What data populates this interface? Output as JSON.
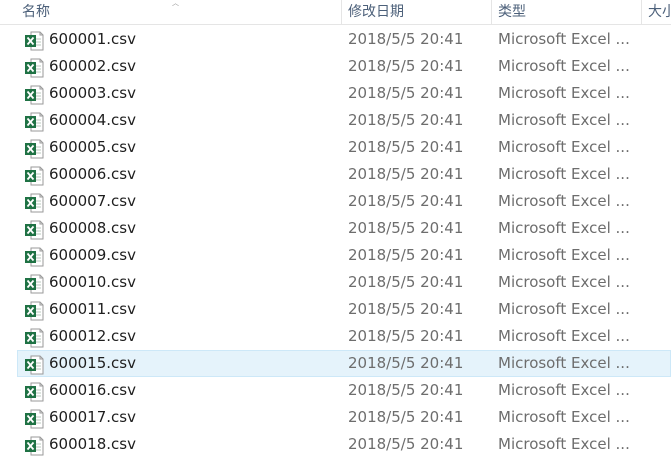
{
  "header": {
    "col_name": "名称",
    "col_date": "修改日期",
    "col_type": "类型",
    "col_size": "大小"
  },
  "files": [
    {
      "name": "600001.csv",
      "date": "2018/5/5 20:41",
      "type": "Microsoft Excel ..."
    },
    {
      "name": "600002.csv",
      "date": "2018/5/5 20:41",
      "type": "Microsoft Excel ..."
    },
    {
      "name": "600003.csv",
      "date": "2018/5/5 20:41",
      "type": "Microsoft Excel ..."
    },
    {
      "name": "600004.csv",
      "date": "2018/5/5 20:41",
      "type": "Microsoft Excel ..."
    },
    {
      "name": "600005.csv",
      "date": "2018/5/5 20:41",
      "type": "Microsoft Excel ..."
    },
    {
      "name": "600006.csv",
      "date": "2018/5/5 20:41",
      "type": "Microsoft Excel ..."
    },
    {
      "name": "600007.csv",
      "date": "2018/5/5 20:41",
      "type": "Microsoft Excel ..."
    },
    {
      "name": "600008.csv",
      "date": "2018/5/5 20:41",
      "type": "Microsoft Excel ..."
    },
    {
      "name": "600009.csv",
      "date": "2018/5/5 20:41",
      "type": "Microsoft Excel ..."
    },
    {
      "name": "600010.csv",
      "date": "2018/5/5 20:41",
      "type": "Microsoft Excel ..."
    },
    {
      "name": "600011.csv",
      "date": "2018/5/5 20:41",
      "type": "Microsoft Excel ..."
    },
    {
      "name": "600012.csv",
      "date": "2018/5/5 20:41",
      "type": "Microsoft Excel ..."
    },
    {
      "name": "600015.csv",
      "date": "2018/5/5 20:41",
      "type": "Microsoft Excel ...",
      "hover": true
    },
    {
      "name": "600016.csv",
      "date": "2018/5/5 20:41",
      "type": "Microsoft Excel ..."
    },
    {
      "name": "600017.csv",
      "date": "2018/5/5 20:41",
      "type": "Microsoft Excel ..."
    },
    {
      "name": "600018.csv",
      "date": "2018/5/5 20:41",
      "type": "Microsoft Excel ..."
    }
  ],
  "icon": {
    "name": "excel-file-icon",
    "color": "#1f7244"
  }
}
